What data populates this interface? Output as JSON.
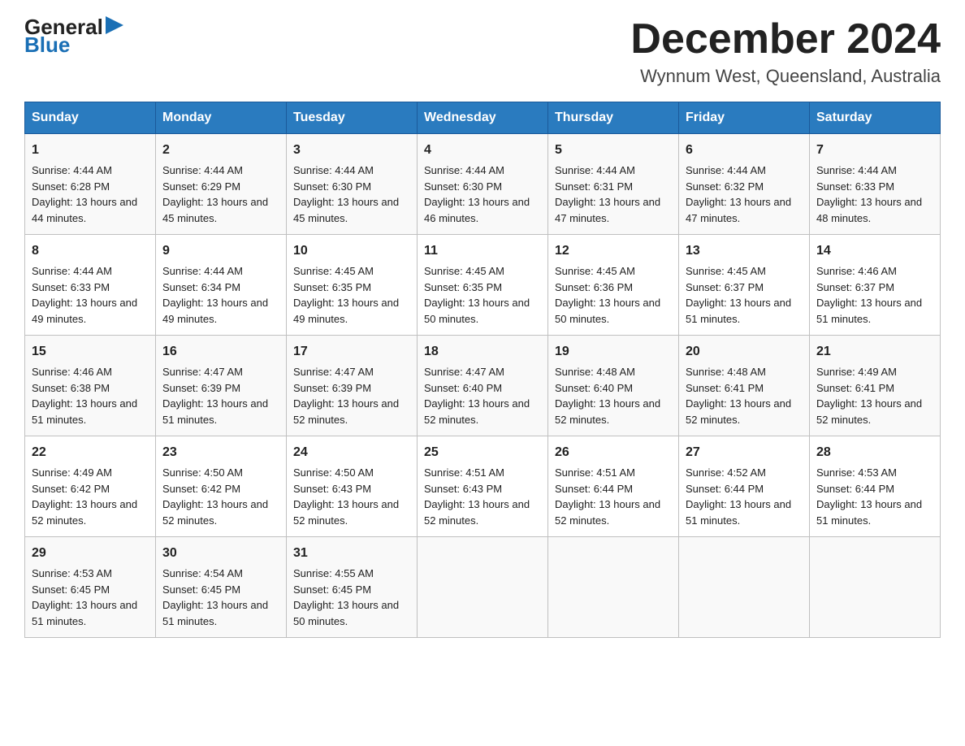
{
  "header": {
    "logo_general": "General",
    "logo_blue": "Blue",
    "title": "December 2024",
    "location": "Wynnum West, Queensland, Australia"
  },
  "days_of_week": [
    "Sunday",
    "Monday",
    "Tuesday",
    "Wednesday",
    "Thursday",
    "Friday",
    "Saturday"
  ],
  "weeks": [
    [
      {
        "day": "1",
        "sunrise": "4:44 AM",
        "sunset": "6:28 PM",
        "daylight": "13 hours and 44 minutes."
      },
      {
        "day": "2",
        "sunrise": "4:44 AM",
        "sunset": "6:29 PM",
        "daylight": "13 hours and 45 minutes."
      },
      {
        "day": "3",
        "sunrise": "4:44 AM",
        "sunset": "6:30 PM",
        "daylight": "13 hours and 45 minutes."
      },
      {
        "day": "4",
        "sunrise": "4:44 AM",
        "sunset": "6:30 PM",
        "daylight": "13 hours and 46 minutes."
      },
      {
        "day": "5",
        "sunrise": "4:44 AM",
        "sunset": "6:31 PM",
        "daylight": "13 hours and 47 minutes."
      },
      {
        "day": "6",
        "sunrise": "4:44 AM",
        "sunset": "6:32 PM",
        "daylight": "13 hours and 47 minutes."
      },
      {
        "day": "7",
        "sunrise": "4:44 AM",
        "sunset": "6:33 PM",
        "daylight": "13 hours and 48 minutes."
      }
    ],
    [
      {
        "day": "8",
        "sunrise": "4:44 AM",
        "sunset": "6:33 PM",
        "daylight": "13 hours and 49 minutes."
      },
      {
        "day": "9",
        "sunrise": "4:44 AM",
        "sunset": "6:34 PM",
        "daylight": "13 hours and 49 minutes."
      },
      {
        "day": "10",
        "sunrise": "4:45 AM",
        "sunset": "6:35 PM",
        "daylight": "13 hours and 49 minutes."
      },
      {
        "day": "11",
        "sunrise": "4:45 AM",
        "sunset": "6:35 PM",
        "daylight": "13 hours and 50 minutes."
      },
      {
        "day": "12",
        "sunrise": "4:45 AM",
        "sunset": "6:36 PM",
        "daylight": "13 hours and 50 minutes."
      },
      {
        "day": "13",
        "sunrise": "4:45 AM",
        "sunset": "6:37 PM",
        "daylight": "13 hours and 51 minutes."
      },
      {
        "day": "14",
        "sunrise": "4:46 AM",
        "sunset": "6:37 PM",
        "daylight": "13 hours and 51 minutes."
      }
    ],
    [
      {
        "day": "15",
        "sunrise": "4:46 AM",
        "sunset": "6:38 PM",
        "daylight": "13 hours and 51 minutes."
      },
      {
        "day": "16",
        "sunrise": "4:47 AM",
        "sunset": "6:39 PM",
        "daylight": "13 hours and 51 minutes."
      },
      {
        "day": "17",
        "sunrise": "4:47 AM",
        "sunset": "6:39 PM",
        "daylight": "13 hours and 52 minutes."
      },
      {
        "day": "18",
        "sunrise": "4:47 AM",
        "sunset": "6:40 PM",
        "daylight": "13 hours and 52 minutes."
      },
      {
        "day": "19",
        "sunrise": "4:48 AM",
        "sunset": "6:40 PM",
        "daylight": "13 hours and 52 minutes."
      },
      {
        "day": "20",
        "sunrise": "4:48 AM",
        "sunset": "6:41 PM",
        "daylight": "13 hours and 52 minutes."
      },
      {
        "day": "21",
        "sunrise": "4:49 AM",
        "sunset": "6:41 PM",
        "daylight": "13 hours and 52 minutes."
      }
    ],
    [
      {
        "day": "22",
        "sunrise": "4:49 AM",
        "sunset": "6:42 PM",
        "daylight": "13 hours and 52 minutes."
      },
      {
        "day": "23",
        "sunrise": "4:50 AM",
        "sunset": "6:42 PM",
        "daylight": "13 hours and 52 minutes."
      },
      {
        "day": "24",
        "sunrise": "4:50 AM",
        "sunset": "6:43 PM",
        "daylight": "13 hours and 52 minutes."
      },
      {
        "day": "25",
        "sunrise": "4:51 AM",
        "sunset": "6:43 PM",
        "daylight": "13 hours and 52 minutes."
      },
      {
        "day": "26",
        "sunrise": "4:51 AM",
        "sunset": "6:44 PM",
        "daylight": "13 hours and 52 minutes."
      },
      {
        "day": "27",
        "sunrise": "4:52 AM",
        "sunset": "6:44 PM",
        "daylight": "13 hours and 51 minutes."
      },
      {
        "day": "28",
        "sunrise": "4:53 AM",
        "sunset": "6:44 PM",
        "daylight": "13 hours and 51 minutes."
      }
    ],
    [
      {
        "day": "29",
        "sunrise": "4:53 AM",
        "sunset": "6:45 PM",
        "daylight": "13 hours and 51 minutes."
      },
      {
        "day": "30",
        "sunrise": "4:54 AM",
        "sunset": "6:45 PM",
        "daylight": "13 hours and 51 minutes."
      },
      {
        "day": "31",
        "sunrise": "4:55 AM",
        "sunset": "6:45 PM",
        "daylight": "13 hours and 50 minutes."
      },
      null,
      null,
      null,
      null
    ]
  ]
}
